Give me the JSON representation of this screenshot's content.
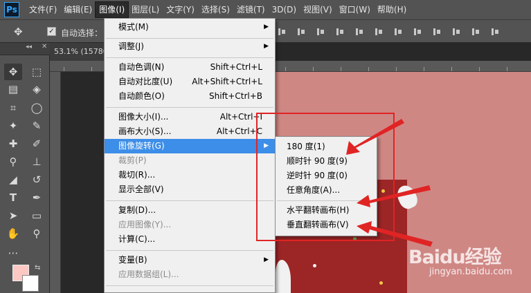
{
  "app": {
    "logo": "Ps"
  },
  "menubar": {
    "items": [
      "文件(F)",
      "编辑(E)",
      "图像(I)",
      "图层(L)",
      "文字(Y)",
      "选择(S)",
      "滤镜(T)",
      "3D(D)",
      "视图(V)",
      "窗口(W)",
      "帮助(H)"
    ],
    "active_index": 2
  },
  "optionsbar": {
    "auto_select_label": "自动选择：",
    "auto_select_checked": true
  },
  "document": {
    "tab_label": "53.1% (15780"
  },
  "colors": {
    "foreground": "#fcc8c3",
    "background": "#ffffff",
    "menu_highlight": "#3d8ee8",
    "annotation_red": "#e02424"
  },
  "image_menu": {
    "items": [
      {
        "label": "模式(M)",
        "shortcut": "",
        "submenu": true,
        "disabled": false,
        "highlighted": false
      },
      {
        "label": "调整(J)",
        "shortcut": "",
        "submenu": true,
        "disabled": false,
        "highlighted": false
      },
      {
        "label": "自动色调(N)",
        "shortcut": "Shift+Ctrl+L",
        "submenu": false,
        "disabled": false,
        "highlighted": false
      },
      {
        "label": "自动对比度(U)",
        "shortcut": "Alt+Shift+Ctrl+L",
        "submenu": false,
        "disabled": false,
        "highlighted": false
      },
      {
        "label": "自动颜色(O)",
        "shortcut": "Shift+Ctrl+B",
        "submenu": false,
        "disabled": false,
        "highlighted": false
      },
      {
        "label": "图像大小(I)...",
        "shortcut": "Alt+Ctrl+I",
        "submenu": false,
        "disabled": false,
        "highlighted": false
      },
      {
        "label": "画布大小(S)...",
        "shortcut": "Alt+Ctrl+C",
        "submenu": false,
        "disabled": false,
        "highlighted": false
      },
      {
        "label": "图像旋转(G)",
        "shortcut": "",
        "submenu": true,
        "disabled": false,
        "highlighted": true
      },
      {
        "label": "裁剪(P)",
        "shortcut": "",
        "submenu": false,
        "disabled": true,
        "highlighted": false
      },
      {
        "label": "裁切(R)...",
        "shortcut": "",
        "submenu": false,
        "disabled": false,
        "highlighted": false
      },
      {
        "label": "显示全部(V)",
        "shortcut": "",
        "submenu": false,
        "disabled": false,
        "highlighted": false
      },
      {
        "label": "复制(D)...",
        "shortcut": "",
        "submenu": false,
        "disabled": false,
        "highlighted": false
      },
      {
        "label": "应用图像(Y)...",
        "shortcut": "",
        "submenu": false,
        "disabled": true,
        "highlighted": false
      },
      {
        "label": "计算(C)...",
        "shortcut": "",
        "submenu": false,
        "disabled": false,
        "highlighted": false
      },
      {
        "label": "变量(B)",
        "shortcut": "",
        "submenu": true,
        "disabled": false,
        "highlighted": false
      },
      {
        "label": "应用数据组(L)...",
        "shortcut": "",
        "submenu": false,
        "disabled": true,
        "highlighted": false
      }
    ]
  },
  "rotate_submenu": {
    "items": [
      "180 度(1)",
      "顺时针 90 度(9)",
      "逆时针 90 度(0)",
      "任意角度(A)...",
      "水平翻转画布(H)",
      "垂直翻转画布(V)"
    ]
  },
  "watermark": {
    "brand": "Baidu经验",
    "url": "jingyan.baidu.com"
  }
}
